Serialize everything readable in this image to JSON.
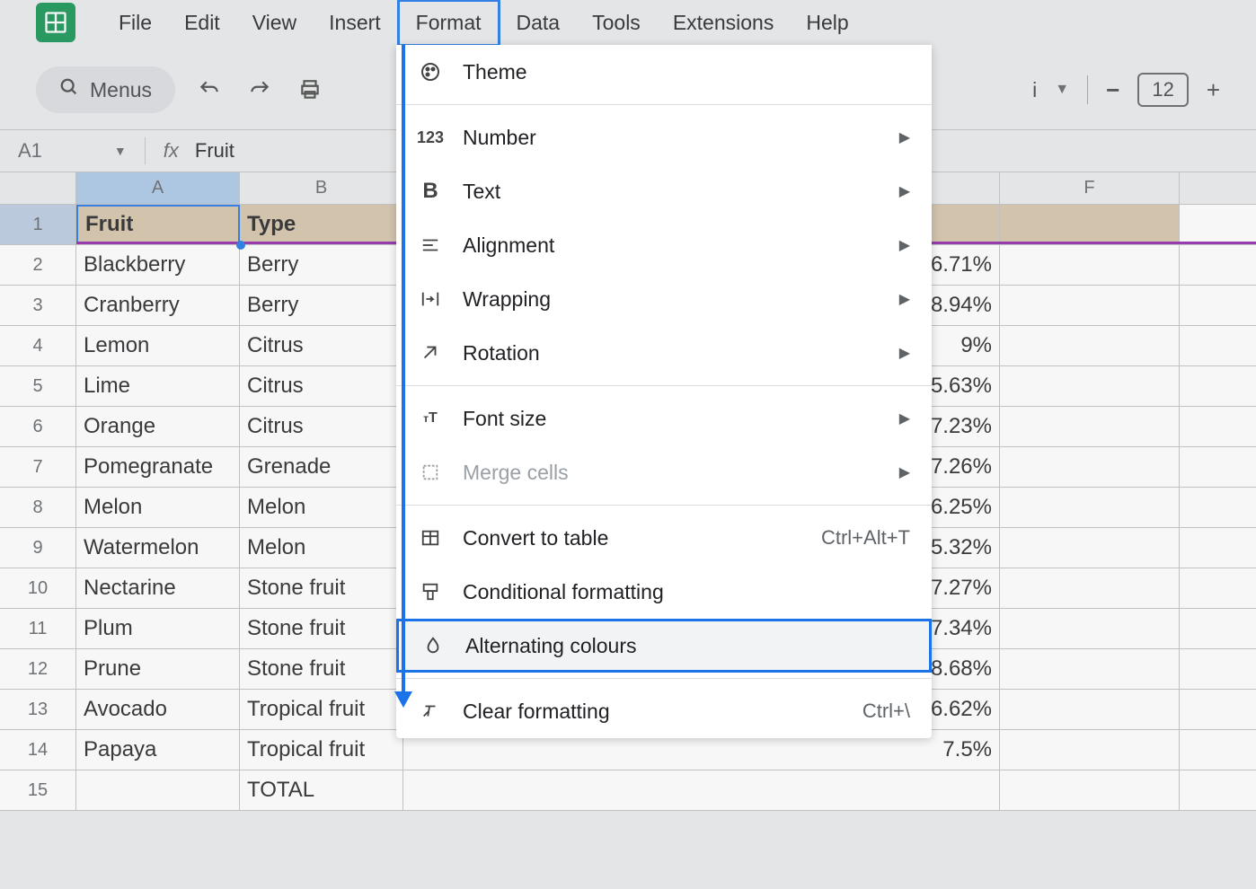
{
  "menubar": [
    "File",
    "Edit",
    "View",
    "Insert",
    "Format",
    "Data",
    "Tools",
    "Extensions",
    "Help"
  ],
  "toolbar": {
    "menus_label": "Menus",
    "font_dropdown_suffix": "i",
    "font_size": "12"
  },
  "name_box": "A1",
  "fx_value": "Fruit",
  "columns": [
    "A",
    "B",
    "F"
  ],
  "header_row": {
    "A": "Fruit",
    "B": "Type"
  },
  "rows": [
    {
      "n": "2",
      "A": "Blackberry",
      "B": "Berry",
      "E": "6.71%"
    },
    {
      "n": "3",
      "A": "Cranberry",
      "B": "Berry",
      "E": "8.94%"
    },
    {
      "n": "4",
      "A": "Lemon",
      "B": "Citrus",
      "E": "9%"
    },
    {
      "n": "5",
      "A": "Lime",
      "B": "Citrus",
      "E": "5.63%"
    },
    {
      "n": "6",
      "A": "Orange",
      "B": "Citrus",
      "E": "7.23%"
    },
    {
      "n": "7",
      "A": "Pomegranate",
      "B": "Grenade",
      "E": "7.26%"
    },
    {
      "n": "8",
      "A": "Melon",
      "B": "Melon",
      "E": "6.25%"
    },
    {
      "n": "9",
      "A": "Watermelon",
      "B": "Melon",
      "E": "5.32%"
    },
    {
      "n": "10",
      "A": "Nectarine",
      "B": "Stone fruit",
      "E": "7.27%"
    },
    {
      "n": "11",
      "A": "Plum",
      "B": "Stone fruit",
      "E": "7.34%"
    },
    {
      "n": "12",
      "A": "Prune",
      "B": "Stone fruit",
      "E": "8.68%"
    },
    {
      "n": "13",
      "A": "Avocado",
      "B": "Tropical fruit",
      "E": "6.62%"
    },
    {
      "n": "14",
      "A": "Papaya",
      "B": "Tropical fruit",
      "E": "7.5%"
    },
    {
      "n": "15",
      "A": "",
      "B": "TOTAL",
      "E": ""
    }
  ],
  "format_menu": {
    "theme": "Theme",
    "number": "Number",
    "text": "Text",
    "alignment": "Alignment",
    "wrapping": "Wrapping",
    "rotation": "Rotation",
    "font_size": "Font size",
    "merge_cells": "Merge cells",
    "convert_table": "Convert to table",
    "convert_shortcut": "Ctrl+Alt+T",
    "conditional": "Conditional formatting",
    "alternating": "Alternating colours",
    "clear": "Clear formatting",
    "clear_shortcut": "Ctrl+\\"
  }
}
